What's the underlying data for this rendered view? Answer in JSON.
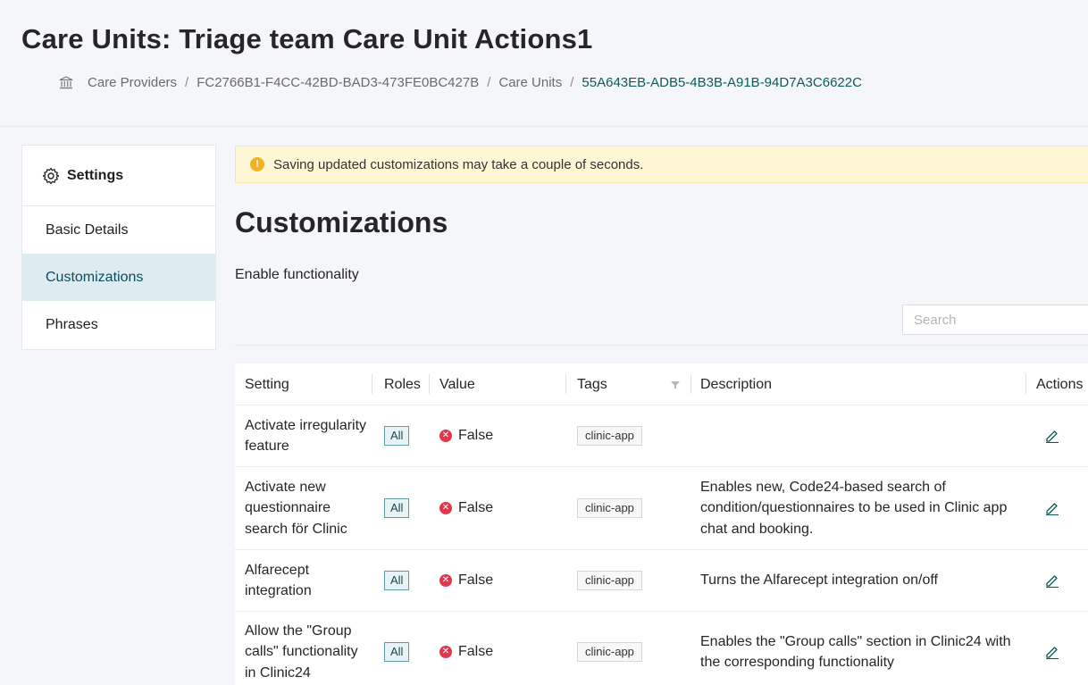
{
  "header": {
    "title": "Care Units: Triage team Care Unit Actions1",
    "breadcrumb": {
      "home_icon": "bank-icon",
      "items": [
        "Care Providers",
        "FC2766B1-F4CC-42BD-BAD3-473FE0BC427B",
        "Care Units"
      ],
      "current": "55A643EB-ADB5-4B3B-A91B-94D7A3C6622C",
      "separator": "/"
    }
  },
  "sidebar": {
    "heading": "Settings",
    "heading_icon": "gear-icon",
    "items": [
      {
        "label": "Basic Details",
        "active": false
      },
      {
        "label": "Customizations",
        "active": true
      },
      {
        "label": "Phrases",
        "active": false
      }
    ]
  },
  "alert": {
    "icon": "warning-icon",
    "icon_glyph": "!",
    "text": "Saving updated customizations may take a couple of seconds."
  },
  "main": {
    "title": "Customizations",
    "subtitle": "Enable functionality",
    "search": {
      "placeholder": "Search",
      "value": "",
      "icon": "search-icon"
    }
  },
  "table": {
    "columns": {
      "setting": "Setting",
      "roles": "Roles",
      "value": "Value",
      "tags": "Tags",
      "description": "Description",
      "actions": "Actions"
    },
    "filter_icon": "filter-icon",
    "rows": [
      {
        "setting": "Activate irregularity feature",
        "role": "All",
        "value": "False",
        "value_icon": "close-circle-icon",
        "tag": "clinic-app",
        "description": "",
        "action_icon": "edit-icon"
      },
      {
        "setting": "Activate new questionnaire search för Clinic",
        "role": "All",
        "value": "False",
        "value_icon": "close-circle-icon",
        "tag": "clinic-app",
        "description": "Enables new, Code24-based search of condition/questionnaires to be used in Clinic app chat and booking.",
        "action_icon": "edit-icon"
      },
      {
        "setting": "Alfarecept integration",
        "role": "All",
        "value": "False",
        "value_icon": "close-circle-icon",
        "tag": "clinic-app",
        "description": "Turns the Alfarecept integration on/off",
        "action_icon": "edit-icon"
      },
      {
        "setting": "Allow the \"Group calls\" functionality in Clinic24",
        "role": "All",
        "value": "False",
        "value_icon": "close-circle-icon",
        "tag": "clinic-app",
        "description": "Enables the \"Group calls\" section in Clinic24 with the corresponding functionality",
        "action_icon": "edit-icon"
      }
    ]
  },
  "colors": {
    "accent": "#0d5a57",
    "active_bg": "#dcecf0",
    "alert_bg": "#fdf7d6",
    "false_red": "#e0374f",
    "warning_orange": "#f0b323"
  }
}
